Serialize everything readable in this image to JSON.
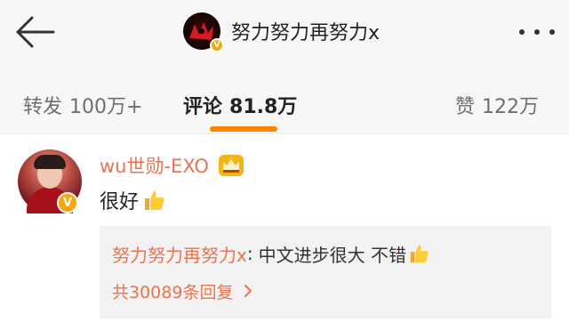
{
  "header": {
    "title": "努力努力再努力x",
    "avatar_icon": "account-logo-icon",
    "verified_icon": "verified-badge-icon"
  },
  "tabs": [
    {
      "label": "转发",
      "count": "100万+"
    },
    {
      "label": "评论",
      "count": "81.8万",
      "active": true
    },
    {
      "label": "赞",
      "count": "122万"
    }
  ],
  "comment": {
    "username": "wu世勋-EXO",
    "badge_icon": "crown-icon",
    "text": "很好",
    "emoji": "thumbs-up-icon",
    "reply": {
      "author": "努力努力再努力x",
      "separator": ":",
      "text": "中文进步很大 不错",
      "emoji": "thumbs-up-icon",
      "more": "共30089条回复"
    }
  },
  "colors": {
    "accent_orange": "#ff8200",
    "link_orange": "#eb7350",
    "verified": "#f7a70a"
  }
}
